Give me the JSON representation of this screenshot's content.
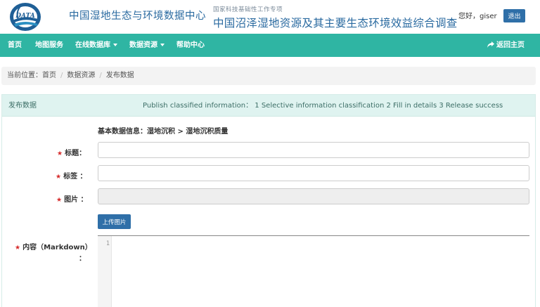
{
  "header": {
    "site_name": "中国湿地生态与环境数据中心",
    "project_label": "国家科技基础性工作专项",
    "project_title": "中国沼泽湿地资源及其主要生态环境效益综合调查",
    "greeting": "您好，giser",
    "logout_label": "退出",
    "logo_text": "DATA",
    "logo_icon": "globe-logo-icon"
  },
  "nav": {
    "items": [
      {
        "label": "首页"
      },
      {
        "label": "地图服务"
      },
      {
        "label": "在线数据库"
      },
      {
        "label": "数据资源"
      },
      {
        "label": "帮助中心"
      }
    ],
    "back_label": "返回主页",
    "back_icon": "share-arrow-icon"
  },
  "breadcrumb": {
    "prefix": "当前位置：",
    "items": [
      "首页",
      "数据资源",
      "发布数据"
    ]
  },
  "panel": {
    "title": "发布数据",
    "steps": "Publish classified information： 1 Selective information classification 2 Fill in details 3 Release success"
  },
  "form": {
    "section_info": "基本数据信息：湿地沉积 > 湿地沉积质量",
    "title_label": "标题：",
    "tags_label": "标签 ：",
    "image_label": "图片 ：",
    "required_mark": "★",
    "title_value": "",
    "tags_value": "",
    "image_value": "",
    "upload_label": "上传图片",
    "content_label_line1": "内容（Markdown）",
    "content_label_line2": "：",
    "editor_line_number": "1"
  },
  "colors": {
    "nav_bg": "#2fb5a3",
    "primary_button": "#2f6fa8",
    "header_text": "#2a6aa0",
    "panel_heading_bg": "#dff3f0",
    "required": "#d62c2c"
  }
}
